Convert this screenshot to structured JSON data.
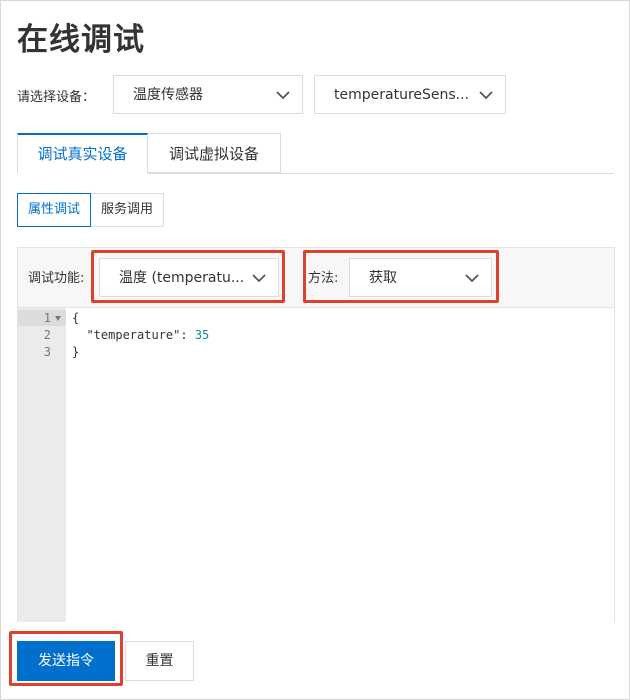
{
  "page": {
    "title": "在线调试"
  },
  "device_select": {
    "label": "请选择设备：",
    "product_value": "温度传感器",
    "device_value": "temperatureSens..."
  },
  "tabs": [
    {
      "label": "调试真实设备",
      "active": true
    },
    {
      "label": "调试虚拟设备",
      "active": false
    }
  ],
  "modes": [
    {
      "label": "属性调试",
      "active": true
    },
    {
      "label": "服务调用",
      "active": false
    }
  ],
  "debug_panel": {
    "function_label": "调试功能:",
    "function_value": "温度 (temperatu...",
    "method_label": "方法:",
    "method_value": "获取"
  },
  "editor": {
    "line_numbers": [
      "1",
      "2",
      "3"
    ],
    "lines": [
      "{",
      "  \"temperature\": ",
      "}"
    ],
    "value": "35"
  },
  "actions": {
    "send_label": "发送指令",
    "reset_label": "重置"
  },
  "colors": {
    "accent": "#0070cc",
    "highlight": "#e0412d"
  }
}
